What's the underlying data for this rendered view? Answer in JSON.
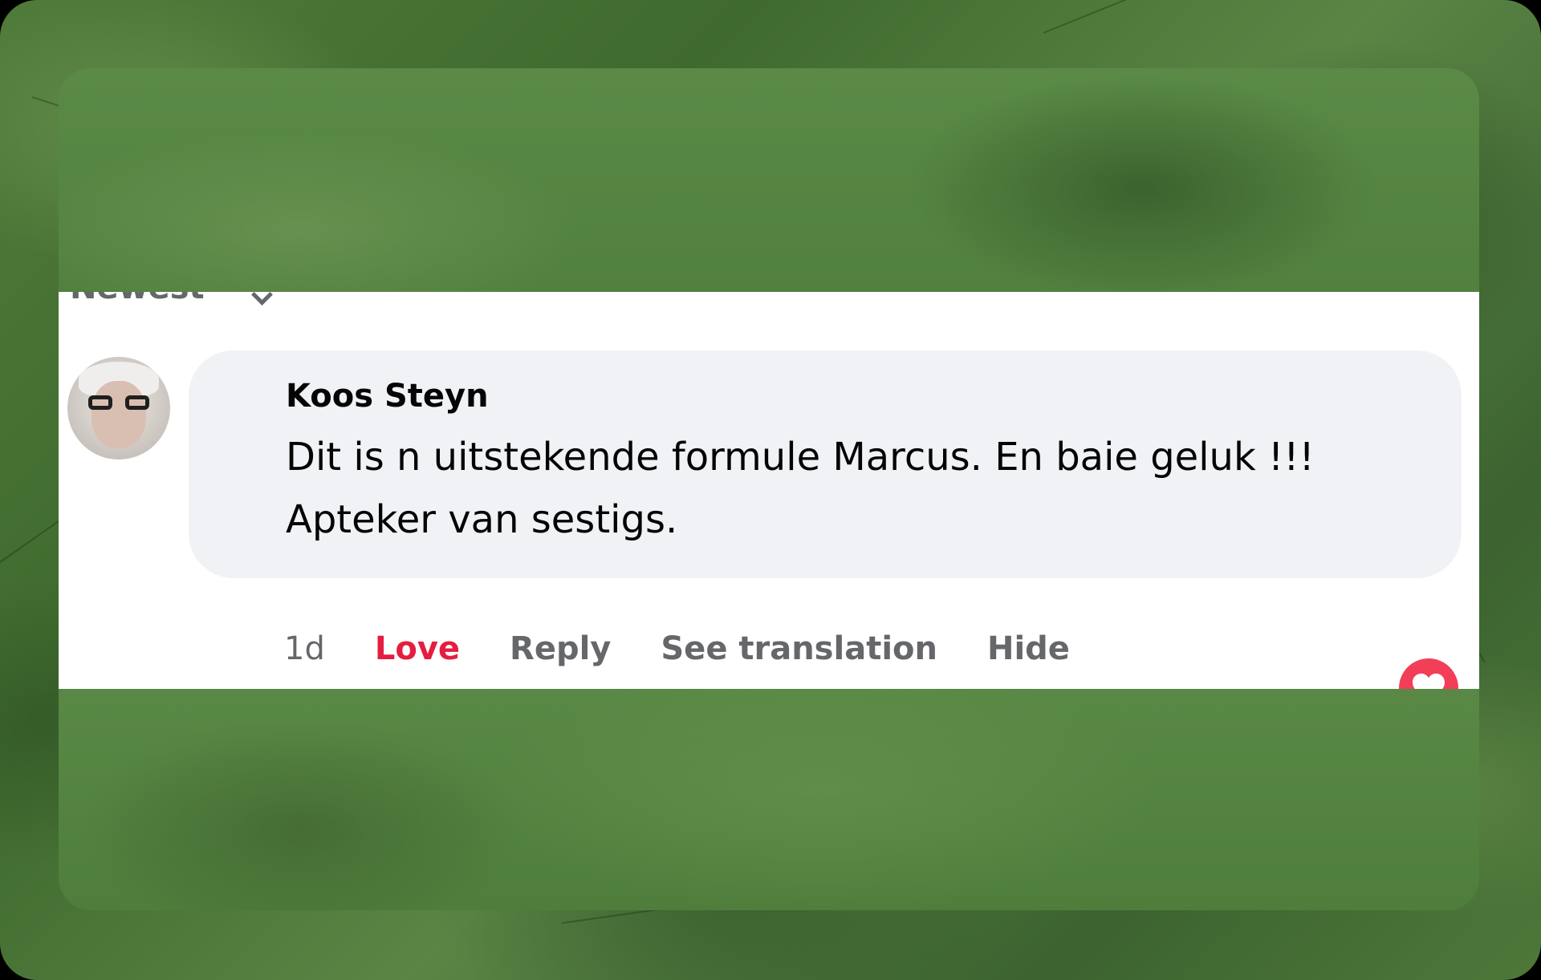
{
  "comments_section": {
    "sort_label": "Newest",
    "comment": {
      "author": "Koos Steyn",
      "text": "Dit is n uitstekende formule Marcus. En baie geluk !!! Apteker van sestigs.",
      "timestamp": "1d",
      "actions": {
        "love": "Love",
        "reply": "Reply",
        "see_translation": "See translation",
        "hide": "Hide"
      },
      "reaction_icon": "love-heart-icon"
    }
  },
  "colors": {
    "love_red": "#e41e3f",
    "reaction_badge": "#f33e58",
    "bubble_bg": "#f0f2f5",
    "secondary_text": "#65676b",
    "background_green": "#4f7a3a"
  }
}
